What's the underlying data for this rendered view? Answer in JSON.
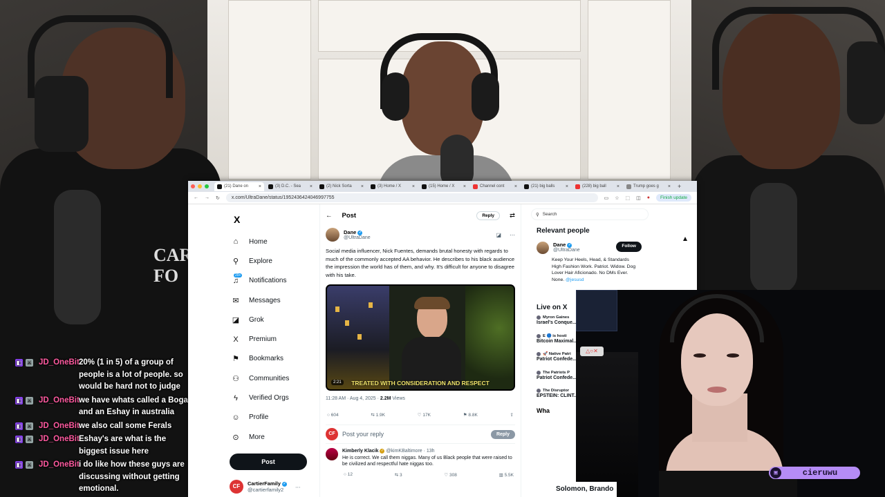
{
  "colors": {
    "x_blue": "#1d9bf0",
    "twitch_purple": "#9146ff",
    "chat_user": "#ff5aa0",
    "nameplate": "#b58cf6"
  },
  "shirt_text": "CAR FO",
  "chat": [
    {
      "user": "JD_OneBit",
      "text": "20% (1 in 5) of a group of people is a lot of people. so would be hard not to judge"
    },
    {
      "user": "JD_OneBit",
      "text": "we have whats called a Bogan and an Eshay in australia"
    },
    {
      "user": "JD_OneBit",
      "text": "we also call some Ferals"
    },
    {
      "user": "JD_OneBit",
      "text": "Eshay's are what is the biggest issue here"
    },
    {
      "user": "JD_OneBit",
      "text": "i do like how these guys are discussing without getting emotional."
    }
  ],
  "browser": {
    "tabs": [
      {
        "label": "(21) Dane on",
        "icon_color": "#111",
        "active": true
      },
      {
        "label": "(3) D.C. - Sea",
        "icon_color": "#111"
      },
      {
        "label": "(2) Nick Sorta",
        "icon_color": "#111"
      },
      {
        "label": "(3) Home / X",
        "icon_color": "#111"
      },
      {
        "label": "(15) Home / X",
        "icon_color": "#111"
      },
      {
        "label": "Channel cont",
        "icon_color": "#e33"
      },
      {
        "label": "(21) big balls",
        "icon_color": "#111"
      },
      {
        "label": "(228) big ball",
        "icon_color": "#e33"
      },
      {
        "label": "Trump goes g",
        "icon_color": "#888"
      }
    ],
    "url": "x.com/UltraDane/status/1952436424046997755",
    "finish_update": "Finish update"
  },
  "nav": {
    "logo": "X",
    "items": [
      {
        "label": "Home",
        "icon": "⌂"
      },
      {
        "label": "Explore",
        "icon": "⚲"
      },
      {
        "label": "Notifications",
        "icon": "🔔",
        "badge": "20+"
      },
      {
        "label": "Messages",
        "icon": "✉"
      },
      {
        "label": "Grok",
        "icon": "◪"
      },
      {
        "label": "Premium",
        "icon": "X"
      },
      {
        "label": "Bookmarks",
        "icon": "⚑"
      },
      {
        "label": "Communities",
        "icon": "👥"
      },
      {
        "label": "Verified Orgs",
        "icon": "ϟ"
      },
      {
        "label": "Profile",
        "icon": "👤"
      },
      {
        "label": "More",
        "icon": "⋯"
      }
    ],
    "post_button": "Post",
    "account": {
      "name": "CartierFamily",
      "handle": "@cartierfamily2"
    }
  },
  "post": {
    "header": "Post",
    "reply_pill": "Reply",
    "author": {
      "name": "Dane",
      "handle": "@UltraDane"
    },
    "text": "Social media influencer, Nick Fuentes, demands brutal honesty with regards to much of the commonly accepted AA behavior. He describes to his black audience the impression the world has of them, and why. It's difficult for anyone to disagree with his take.",
    "video": {
      "duration": "2:21",
      "subtitle": "TREATED WITH CONSIDERATION AND RESPECT"
    },
    "time": "11:28 AM · Aug 4, 2025 · ",
    "views": "2.2M",
    "views_label": " Views",
    "stats": {
      "replies": "604",
      "reposts": "1.9K",
      "likes": "17K",
      "bookmarks": "8.8K"
    },
    "reply_placeholder": "Post your reply",
    "reply_button": "Reply",
    "comment": {
      "name": "Kimberly Klacik",
      "handle": "@kimKBaltimore · 13h",
      "text": "He is correct. We call them niggas. Many of us Black people that were raised to be civilized and respectful hate niggas too.",
      "stats": {
        "replies": "12",
        "reposts": "3",
        "likes": "308",
        "views": "5.5K"
      }
    }
  },
  "sidebar": {
    "search_placeholder": "Search",
    "relevant_title": "Relevant people",
    "person": {
      "name": "Dane",
      "handle": "@UltraDane",
      "follow": "Follow",
      "bio": "Keep Your Heels, Head, & Standards High Fashion Work. Patriot. Widow. Dog Lover Hair Aficionado. No DMs Ever. None.",
      "bio_mention": "@jesusd"
    },
    "live_title": "Live on X",
    "live": [
      {
        "host": "Myron Gaines",
        "title": "Israel's Conque... DOJ Grand Jury"
      },
      {
        "host": "E 🔵 is hosti",
        "title": "Bitcoin Maximal... Kruse EXPOSES"
      },
      {
        "host": "🚀 Native Patri",
        "title": "Patriot Confede... Michael DiBari I"
      },
      {
        "host": "The Patriots P",
        "title": "Patriot Confede... DiBari Interview"
      },
      {
        "host": "The Disruptor",
        "title": "EPSTEIN: CLINT... SUBPOENAED MOR"
      }
    ],
    "whats": "Wha"
  },
  "overlay_name": "Solomon, Brando",
  "streamer": {
    "name": "cieruwu"
  }
}
